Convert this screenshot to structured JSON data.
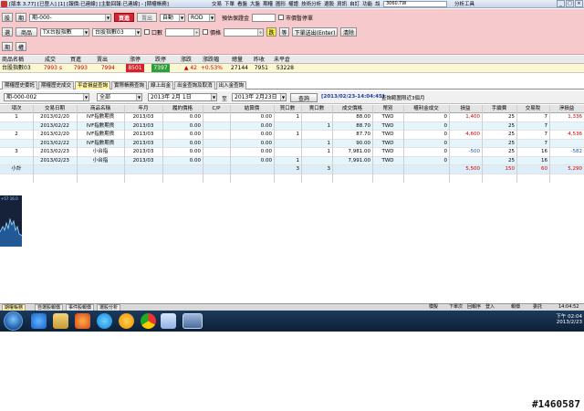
{
  "window": {
    "title": "[版本 3.77] [已登入] [1] [報價:已連線] [主動回報:已連線] - [期權帳務]",
    "menus": [
      "交易",
      "下單",
      "看盤",
      "大盤",
      "期權",
      "圖形",
      "權證",
      "技術分析",
      "選股",
      "資訊",
      "自訂",
      "功能",
      "說明"
    ],
    "symbol_box": "3060.TW",
    "tools_label": "分析工具"
  },
  "order_panel": {
    "row1": {
      "btn_lock": "股",
      "btn_order": "期",
      "account_value": "期-000-",
      "buy_label": "買進",
      "sell_label": "賣出",
      "order_type": "自動",
      "time_in_force": "ROD",
      "margin_label": "預估保證金",
      "auto_stop_label": "市價暫停單"
    },
    "row2": {
      "btn_stock": "選",
      "product_label": "商品",
      "product_value": "TX台股指數",
      "product_month": "台股指數03",
      "qty_label": "口數",
      "qty_value": "",
      "price_label": "價格",
      "price_value": "",
      "btn_confirm": "跌",
      "btn_wait": "等",
      "btn_send": "下單送出(Enter)",
      "btn_clear": "清除"
    },
    "row3": {
      "btn_future": "期",
      "btn_option": "權"
    }
  },
  "quote": {
    "headers": [
      "商品名稱",
      "成交",
      "買進",
      "賣出",
      "漲停",
      "跌停",
      "漲跌",
      "漲跌幅",
      "總量",
      "昨收",
      "未平倉"
    ],
    "row": [
      "台股指數03",
      "7993 s",
      "7993",
      "7994",
      "8501",
      "7397",
      "▲ 42",
      "+0.53%",
      "27144",
      "7951",
      "53228"
    ]
  },
  "tabs": [
    "期權歷史委託",
    "期權歷史成交",
    "平倉損益查詢",
    "實際帳務查詢",
    "線上出金",
    "出金查詢及取消",
    "出入金查詢"
  ],
  "filters": {
    "account": "期-000-002",
    "category": "全部",
    "start_date": "2013年 2月 1日",
    "range_sep": "至",
    "end_date": "2013年 2月23日",
    "query_button": "查詢",
    "range_text": "[2013/02/23-14:04:45]",
    "hint_text": "查詢範圍限近3個月"
  },
  "grid": {
    "headers": [
      "項次",
      "交易日期",
      "商品名稱",
      "年月",
      "履約價格",
      "C/P",
      "結算價",
      "買口數",
      "賣口數",
      "成交價格",
      "幣別",
      "權利金成交",
      "損益",
      "手續費",
      "交易稅",
      "淨損益"
    ],
    "rows": [
      {
        "cells": [
          "1",
          "2013/02/20",
          "IVF指數期貨",
          "2013/03",
          "0.00",
          "",
          "0.00",
          "1",
          "",
          "88.00",
          "TWD",
          "0",
          "1,400",
          "25",
          "7",
          "1,336"
        ],
        "style": ""
      },
      {
        "cells": [
          "",
          "2013/02/22",
          "IVF指數期貨",
          "2013/03",
          "0.00",
          "",
          "0.00",
          "",
          "1",
          "88.70",
          "TWD",
          "0",
          "",
          "25",
          "7",
          ""
        ],
        "style": "blue"
      },
      {
        "cells": [
          "2",
          "2013/02/20",
          "IVF指數期貨",
          "2013/03",
          "0.00",
          "",
          "0.00",
          "1",
          "",
          "87.70",
          "TWD",
          "0",
          "4,600",
          "25",
          "7",
          "4,536"
        ],
        "style": ""
      },
      {
        "cells": [
          "",
          "2013/02/22",
          "IVF指數期貨",
          "2013/03",
          "0.00",
          "",
          "0.00",
          "",
          "1",
          "90.00",
          "TWD",
          "0",
          "",
          "25",
          "7",
          ""
        ],
        "style": "blue"
      },
      {
        "cells": [
          "3",
          "2013/02/23",
          "小台指",
          "2013/03",
          "0.00",
          "",
          "0.00",
          "",
          "1",
          "7,981.00",
          "TWD",
          "0",
          "-500",
          "25",
          "16",
          "-582"
        ],
        "style": ""
      },
      {
        "cells": [
          "",
          "2013/02/23",
          "小台指",
          "2013/03",
          "0.00",
          "",
          "0.00",
          "1",
          "",
          "7,991.00",
          "TWD",
          "0",
          "",
          "25",
          "16",
          ""
        ],
        "style": "blue"
      }
    ],
    "total": {
      "label": "小計",
      "buy": "3",
      "sell": "3",
      "pnl": "5,500",
      "fee": "150",
      "tax": "60",
      "net": "5,290"
    }
  },
  "minichart_label": "+57  16.0",
  "statusbar": {
    "tabs": [
      "期權帳務",
      "自選股報價",
      "事件股報價",
      "選股分析"
    ],
    "items": [
      "模擬",
      "下單次",
      "回報序",
      "登入"
    ],
    "labels_right": [
      "報價",
      "委託",
      "14:04:52"
    ]
  },
  "taskbar": {
    "time": "下午 02:04",
    "date": "2013/2/23"
  },
  "watermark": "#1460587",
  "colors": {
    "order_panel_bg": "#f6c9cc",
    "quote_row_bg": "#fbf7d0",
    "up": "#d00000",
    "down": "#2255cc",
    "active_tab": "#fff4a8"
  }
}
